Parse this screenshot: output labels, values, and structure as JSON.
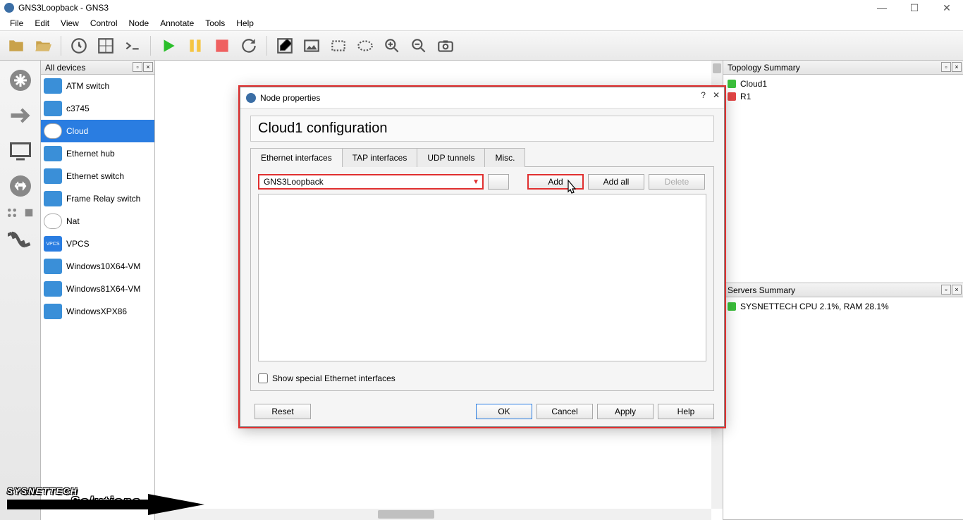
{
  "window": {
    "title": "GNS3Loopback - GNS3"
  },
  "menu": [
    "File",
    "Edit",
    "View",
    "Control",
    "Node",
    "Annotate",
    "Tools",
    "Help"
  ],
  "devices_panel": {
    "title": "All devices",
    "items": [
      {
        "label": "ATM switch",
        "icon": "atm"
      },
      {
        "label": "c3745",
        "icon": "router"
      },
      {
        "label": "Cloud",
        "icon": "cloud",
        "selected": true
      },
      {
        "label": "Ethernet hub",
        "icon": "hub"
      },
      {
        "label": "Ethernet switch",
        "icon": "switch"
      },
      {
        "label": "Frame Relay switch",
        "icon": "fr"
      },
      {
        "label": "Nat",
        "icon": "nat"
      },
      {
        "label": "VPCS",
        "icon": "vpcs"
      },
      {
        "label": "Windows10X64-VM",
        "icon": "vm"
      },
      {
        "label": "Windows81X64-VM",
        "icon": "vm"
      },
      {
        "label": "WindowsXPX86",
        "icon": "vm"
      }
    ]
  },
  "topology": {
    "title": "Topology Summary",
    "items": [
      {
        "label": "Cloud1",
        "status": "green"
      },
      {
        "label": "R1",
        "status": "red"
      }
    ]
  },
  "servers": {
    "title": "Servers Summary",
    "items": [
      {
        "label": "SYSNETTECH CPU 2.1%, RAM 28.1%",
        "status": "green"
      }
    ]
  },
  "dialog": {
    "title": "Node properties",
    "heading": "Cloud1 configuration",
    "tabs": [
      "Ethernet interfaces",
      "TAP interfaces",
      "UDP tunnels",
      "Misc."
    ],
    "active_tab": 0,
    "interface_selected": "GNS3Loopback",
    "buttons": {
      "add": "Add",
      "addall": "Add all",
      "delete": "Delete"
    },
    "checkbox": "Show special Ethernet interfaces",
    "footer": {
      "reset": "Reset",
      "ok": "OK",
      "cancel": "Cancel",
      "apply": "Apply",
      "help": "Help"
    }
  },
  "watermark": {
    "line1": "SYSNETTECH",
    "line2": "Solutions"
  }
}
